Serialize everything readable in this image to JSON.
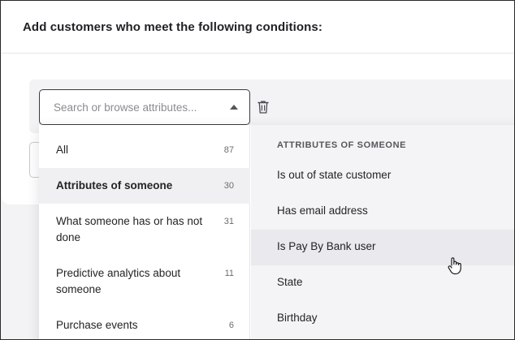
{
  "header": {
    "title": "Add customers who meet the following conditions:"
  },
  "search": {
    "placeholder": "Search or browse attributes..."
  },
  "categories": [
    {
      "label": "All",
      "count": "87"
    },
    {
      "label": "Attributes of someone",
      "count": "30"
    },
    {
      "label": "What someone has or has not done",
      "count": "31"
    },
    {
      "label": "Predictive analytics about someone",
      "count": "11"
    },
    {
      "label": "Purchase events",
      "count": "6"
    }
  ],
  "attributes": {
    "heading": "ATTRIBUTES OF SOMEONE",
    "items": [
      "Is out of state customer",
      "Has email address",
      "Is Pay By Bank user",
      "State",
      "Birthday"
    ]
  },
  "icons": {
    "delete": "trash-icon",
    "dropdown": "caret-up-icon",
    "cursor": "hand-pointer-icon"
  },
  "colors": {
    "accent_border": "#3a3b3e",
    "active_bg": "#f0f0f3",
    "hover_bg": "#e9e9ee"
  }
}
